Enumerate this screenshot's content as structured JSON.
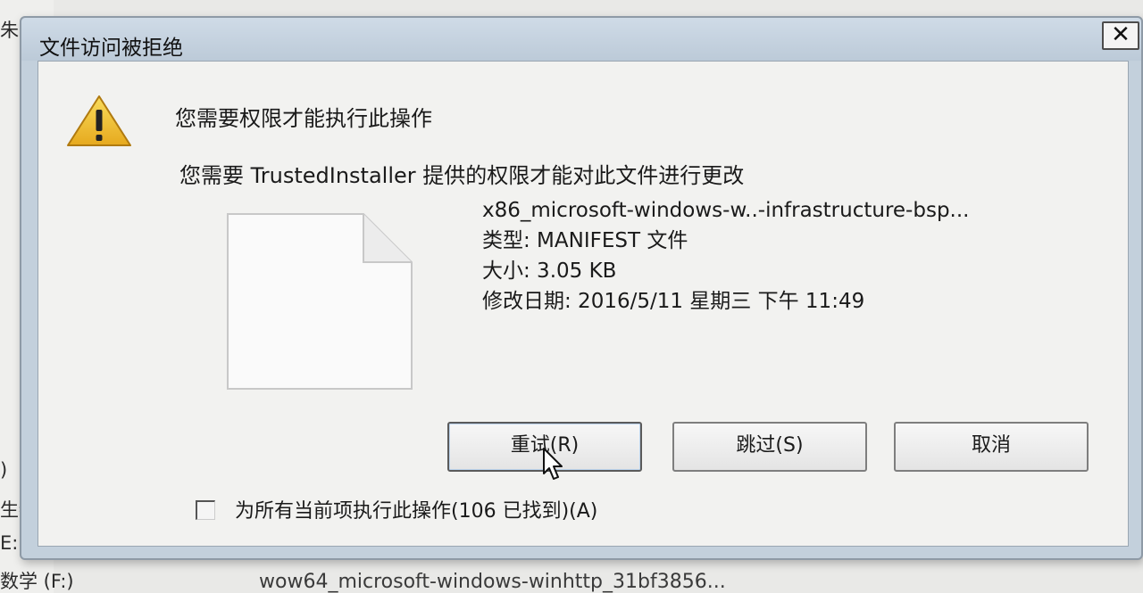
{
  "background": {
    "left_texts": [
      "朱",
      ")",
      "生物加",
      "E:)",
      "数学 (F:)"
    ],
    "bottom_text": "wow64_microsoft-windows-winhttp_31bf3856..."
  },
  "dialog": {
    "title": "文件访问被拒绝",
    "close_label": "✕",
    "heading": "您需要权限才能执行此操作",
    "subheading": "您需要 TrustedInstaller 提供的权限才能对此文件进行更改",
    "file": {
      "name": "x86_microsoft-windows-w..-infrastructure-bsp...",
      "type": "类型: MANIFEST 文件",
      "size": "大小: 3.05 KB",
      "modified": "修改日期: 2016/5/11 星期三 下午 11:49"
    },
    "buttons": {
      "retry": "重试(R)",
      "skip": "跳过(S)",
      "cancel": "取消"
    },
    "checkbox": {
      "label": "为所有当前项执行此操作(106 已找到)(A)",
      "checked": false
    }
  },
  "colors": {
    "titlebar": "#c3d0dc",
    "content_bg": "#f2f2f0",
    "warning_yellow": "#f2c230"
  }
}
